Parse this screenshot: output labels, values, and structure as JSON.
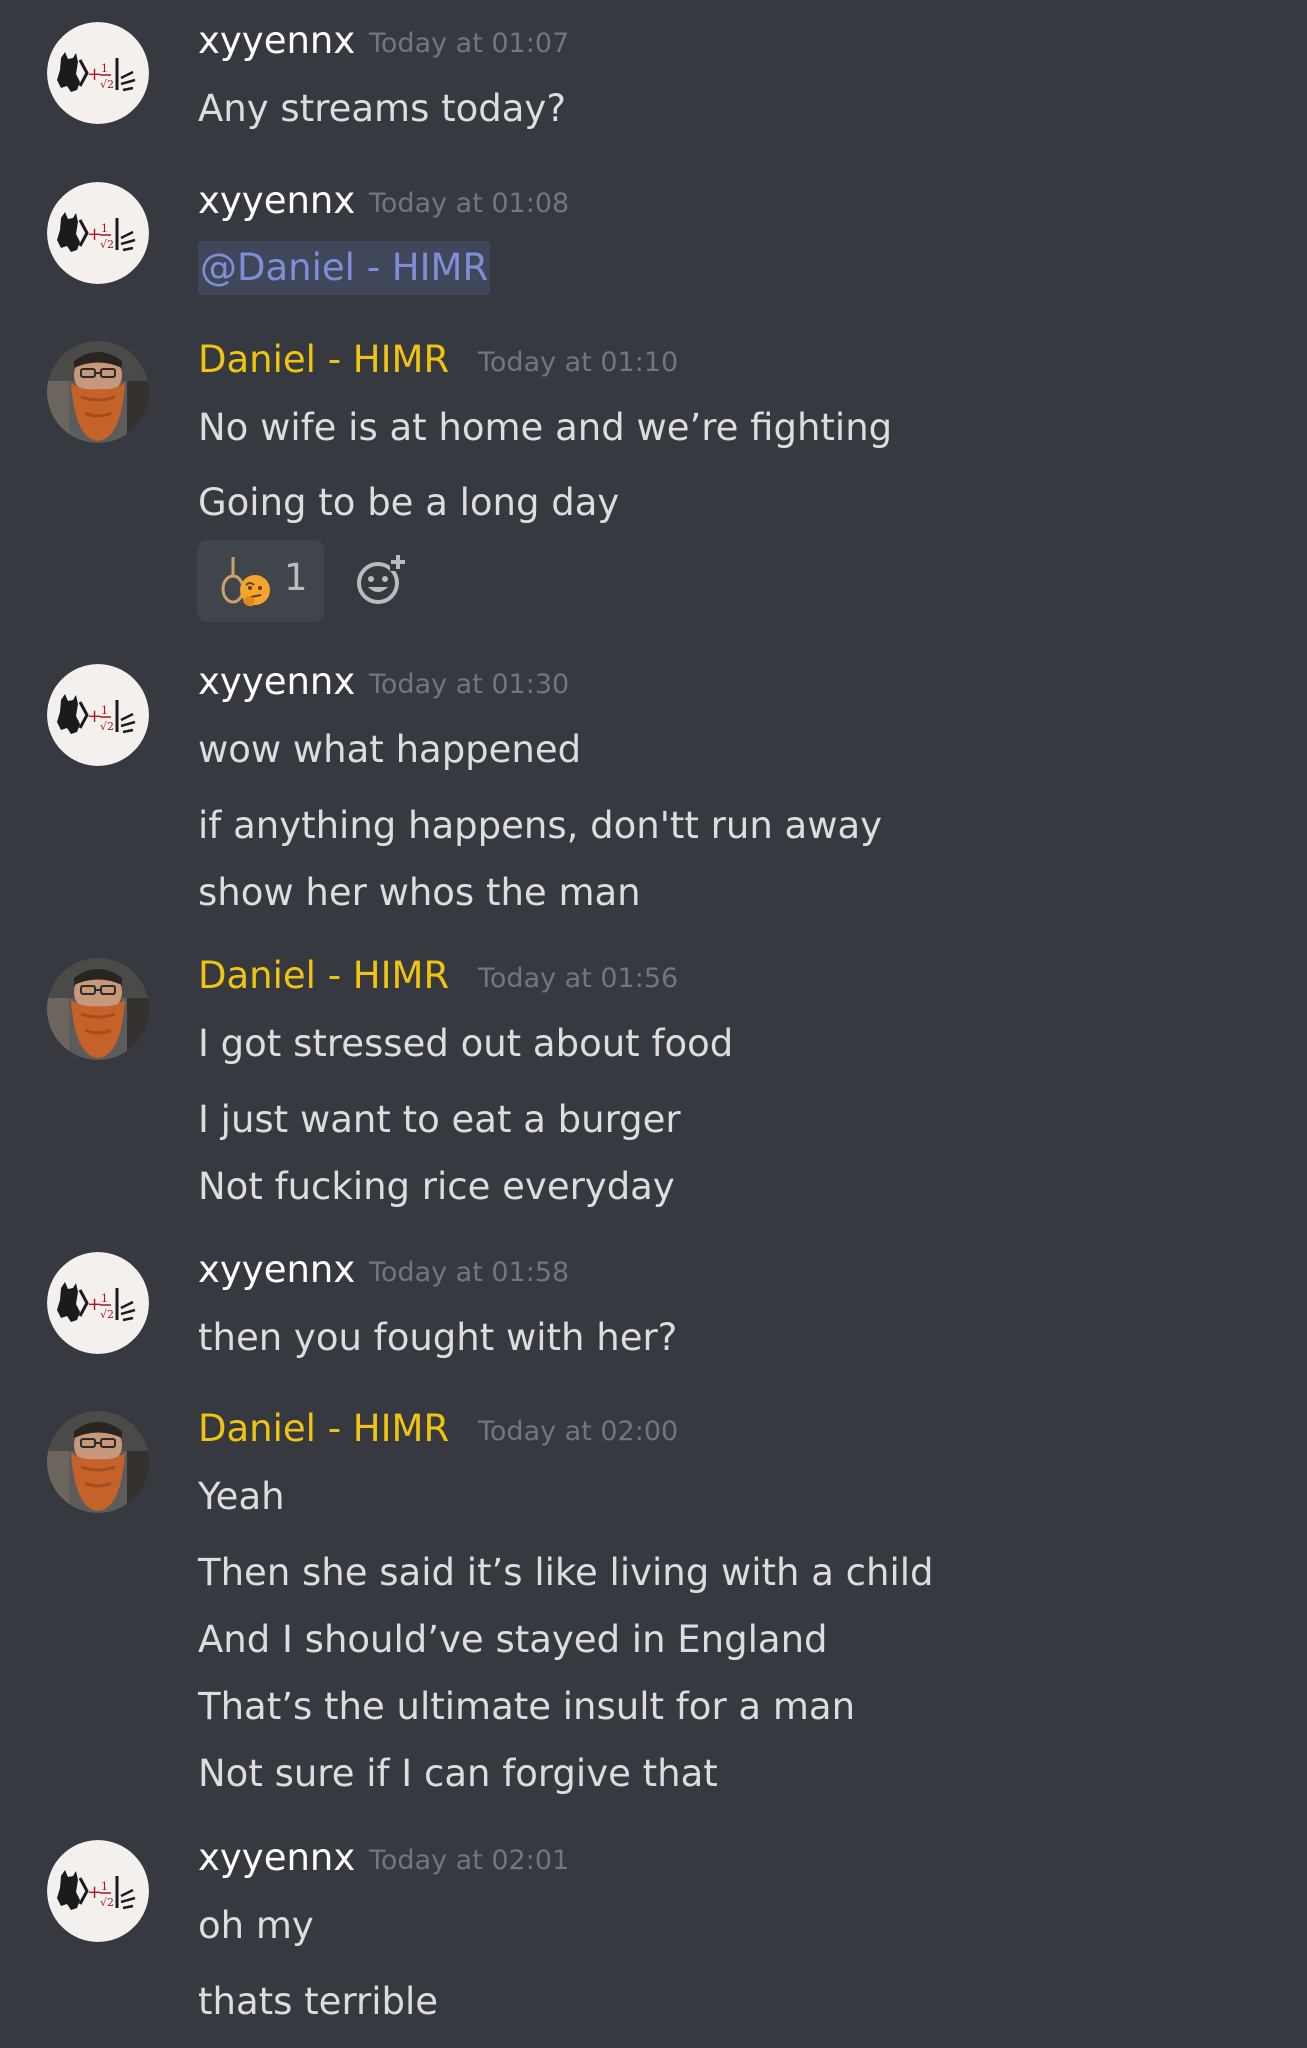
{
  "colors": {
    "background": "#36393f",
    "xyyennx_name": "#ffffff",
    "daniel_name": "#f1c40f",
    "message_text": "#dcddde",
    "timestamp": "#72767d",
    "mention_text": "#7f8ed6"
  },
  "messages": [
    {
      "author": "xyyennx",
      "timestamp": "Today at 01:07",
      "lines": [
        "Any streams today?"
      ]
    },
    {
      "author": "xyyennx",
      "timestamp": "Today at 01:08",
      "mention": "@Daniel - HIMR"
    },
    {
      "author": "Daniel - HIMR",
      "timestamp": "Today at 01:10",
      "lines": [
        "No wife is at home and we’re fighting",
        "Going to be a long day"
      ],
      "reaction": {
        "emoji": "noose-thinking-face-icon",
        "count": "1"
      },
      "add_reaction_icon": "add-reaction-icon"
    },
    {
      "author": "xyyennx",
      "timestamp": "Today at 01:30",
      "lines": [
        "wow what happened",
        "if anything happens, don'tt run away",
        "show her whos the man"
      ]
    },
    {
      "author": "Daniel - HIMR",
      "timestamp": "Today at 01:56",
      "lines": [
        "I got stressed out about food",
        "I just want to eat a burger",
        "Not fucking rice everyday"
      ]
    },
    {
      "author": "xyyennx",
      "timestamp": "Today at 01:58",
      "lines": [
        "then you fought with her?"
      ]
    },
    {
      "author": "Daniel - HIMR",
      "timestamp": "Today at 02:00",
      "lines": [
        "Yeah",
        "Then she said it’s like living with a child",
        "And I should’ve stayed in England",
        "That’s the ultimate insult for a man",
        "Not sure if I can forgive that"
      ]
    },
    {
      "author": "xyyennx",
      "timestamp": "Today at 02:01",
      "lines": [
        "oh my",
        "thats terrible"
      ]
    }
  ]
}
